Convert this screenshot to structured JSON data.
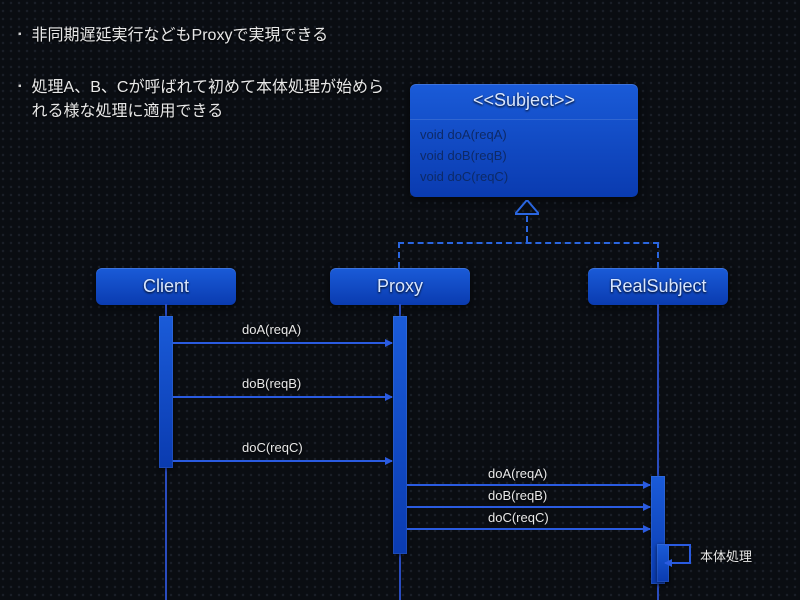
{
  "bullets": [
    "非同期遅延実行などもProxyで実現できる",
    "処理A、B、Cが呼ばれて初めて本体処理が始められる様な処理に適用できる"
  ],
  "subject": {
    "title": "<<Subject>>",
    "methods": [
      "void doA(reqA)",
      "void doB(reqB)",
      "void doC(reqC)"
    ]
  },
  "lanes": {
    "client": "Client",
    "proxy": "Proxy",
    "realsubject": "RealSubject"
  },
  "messages": {
    "clientToProxy": [
      "doA(reqA)",
      "doB(reqB)",
      "doC(reqC)"
    ],
    "proxyToReal": [
      "doA(reqA)",
      "doB(reqB)",
      "doC(reqC)"
    ]
  },
  "selfCall": "本体処理"
}
